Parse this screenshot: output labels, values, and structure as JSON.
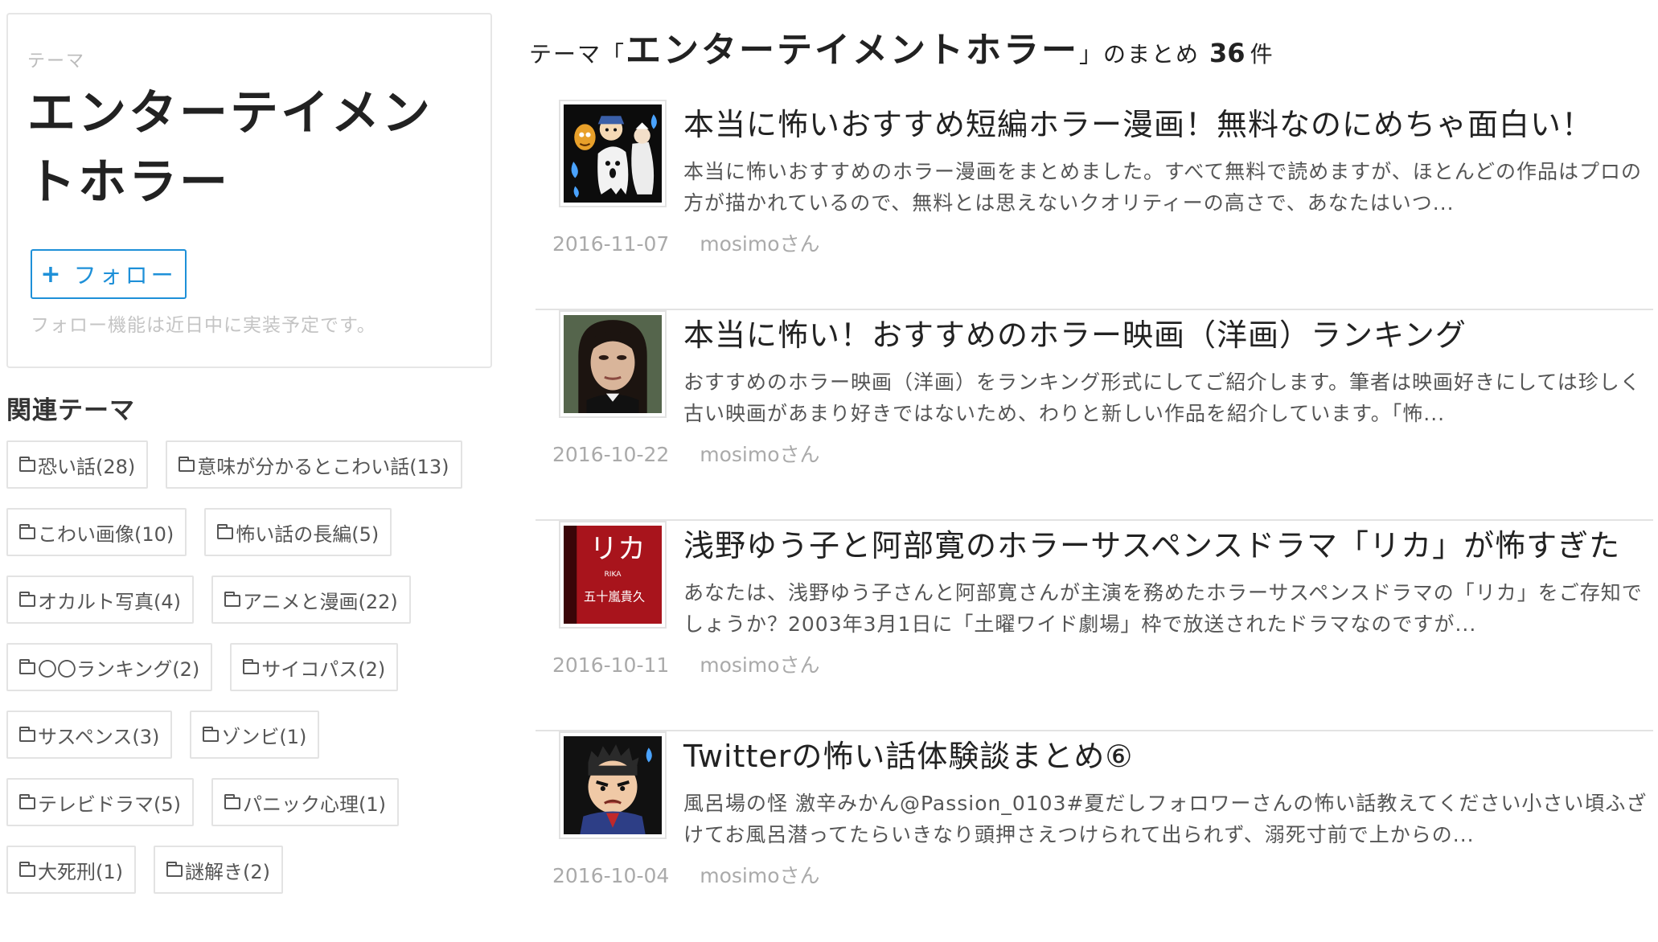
{
  "sidebar": {
    "theme_label": "テーマ",
    "theme_title": "エンターテイメントホラー",
    "follow_button_plus": "+",
    "follow_button_label": "フォロー",
    "follow_note": "フォロー機能は近日中に実装予定です。",
    "related_heading": "関連テーマ",
    "related_tags": [
      [
        "恐い話(28)",
        "意味が分かるとこわい話(13)"
      ],
      [
        "こわい画像(10)",
        "怖い話の長編(5)"
      ],
      [
        "オカルト写真(4)",
        "アニメと漫画(22)"
      ],
      [
        "〇〇ランキング(2)",
        "サイコパス(2)"
      ],
      [
        "サスペンス(3)",
        "ゾンビ(1)"
      ],
      [
        "テレビドラマ(5)",
        "パニック心理(1)"
      ],
      [
        "大死刑(1)",
        "謎解き(2)"
      ]
    ]
  },
  "main": {
    "heading_prefix": "テーマ「",
    "heading_theme": "エンターテイメントホラー",
    "heading_suffix": "」のまとめ",
    "heading_count": "36",
    "heading_unit": "件",
    "articles": [
      {
        "title": "本当に怖いおすすめ短編ホラー漫画！無料なのにめちゃ面白い！",
        "description": "本当に怖いおすすめのホラー漫画をまとめました。すべて無料で読めますが、ほとんどの作品はプロの方が描かれているので、無料とは思えないクオリティーの高さで、あなたはいつ...",
        "date": "2016-11-07",
        "author": "mosimoさん"
      },
      {
        "title": "本当に怖い！おすすめのホラー映画（洋画）ランキング",
        "description": "おすすめのホラー映画（洋画）をランキング形式にしてご紹介します。筆者は映画好きにしては珍しく古い映画があまり好きではないため、わりと新しい作品を紹介しています。「怖...",
        "date": "2016-10-22",
        "author": "mosimoさん"
      },
      {
        "title": "浅野ゆう子と阿部寛のホラーサスペンスドラマ「リカ」が怖すぎた",
        "description": "あなたは、浅野ゆう子さんと阿部寛さんが主演を務めたホラーサスペンスドラマの「リカ」をご存知でしょうか？2003年3月1日に「土曜ワイド劇場」枠で放送されたドラマなのですが...",
        "date": "2016-10-11",
        "author": "mosimoさん",
        "thumb_text_main": "リカ",
        "thumb_text_sub": "RIKA",
        "thumb_text_author": "五十嵐貴久"
      },
      {
        "title": "Twitterの怖い話体験談まとめ⑥",
        "description": "風呂場の怪 激辛みかん@Passion_0103#夏だしフォロワーさんの怖い話教えてください小さい頃ふざけてお風呂潜ってたらいきなり頭押さえつけられて出られず、溺死寸前で上からの...",
        "date": "2016-10-04",
        "author": "mosimoさん"
      }
    ]
  },
  "colors": {
    "accent": "#1e90d8",
    "muted_text": "#aaaaaa",
    "border": "#e3e3e3"
  }
}
